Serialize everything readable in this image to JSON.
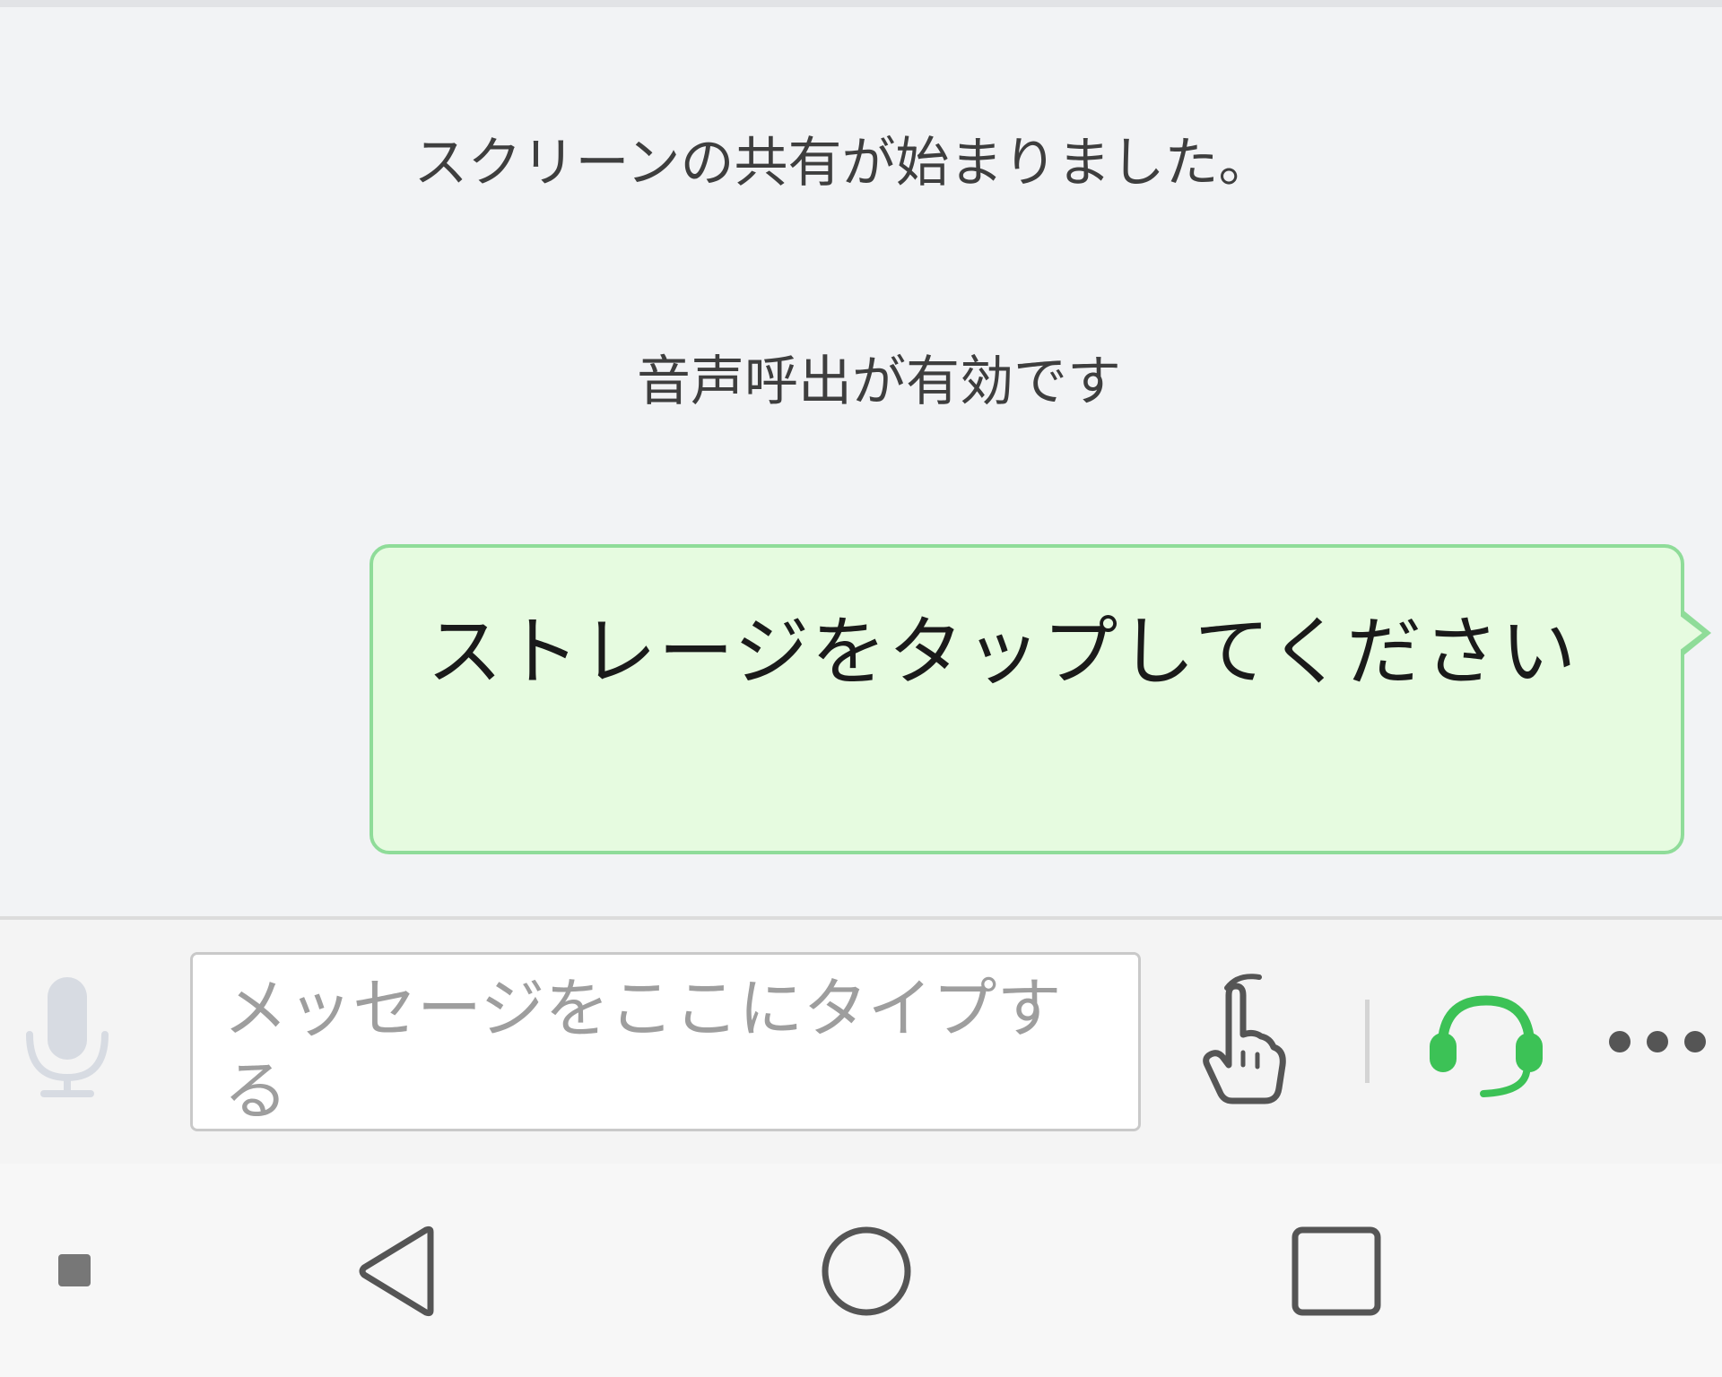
{
  "chat": {
    "system_messages": [
      "スクリーンの共有が始まりました。",
      "音声呼出が有効です"
    ],
    "bubble_text": "ストレージをタップしてください"
  },
  "input_bar": {
    "placeholder": "メッセージをここにタイプする",
    "value": ""
  },
  "icons": {
    "mic": "microphone-icon",
    "hand": "pointing-hand-icon",
    "headset": "headset-icon",
    "more": "more-dots-icon",
    "nav_indicator": "square-dot-icon",
    "back": "back-triangle-icon",
    "home": "home-circle-icon",
    "recent": "recent-apps-square-icon"
  },
  "colors": {
    "bubble_fill": "#e6fbe0",
    "bubble_border": "#8fdc99",
    "accent_green": "#3cc256",
    "background": "#f2f3f5"
  }
}
